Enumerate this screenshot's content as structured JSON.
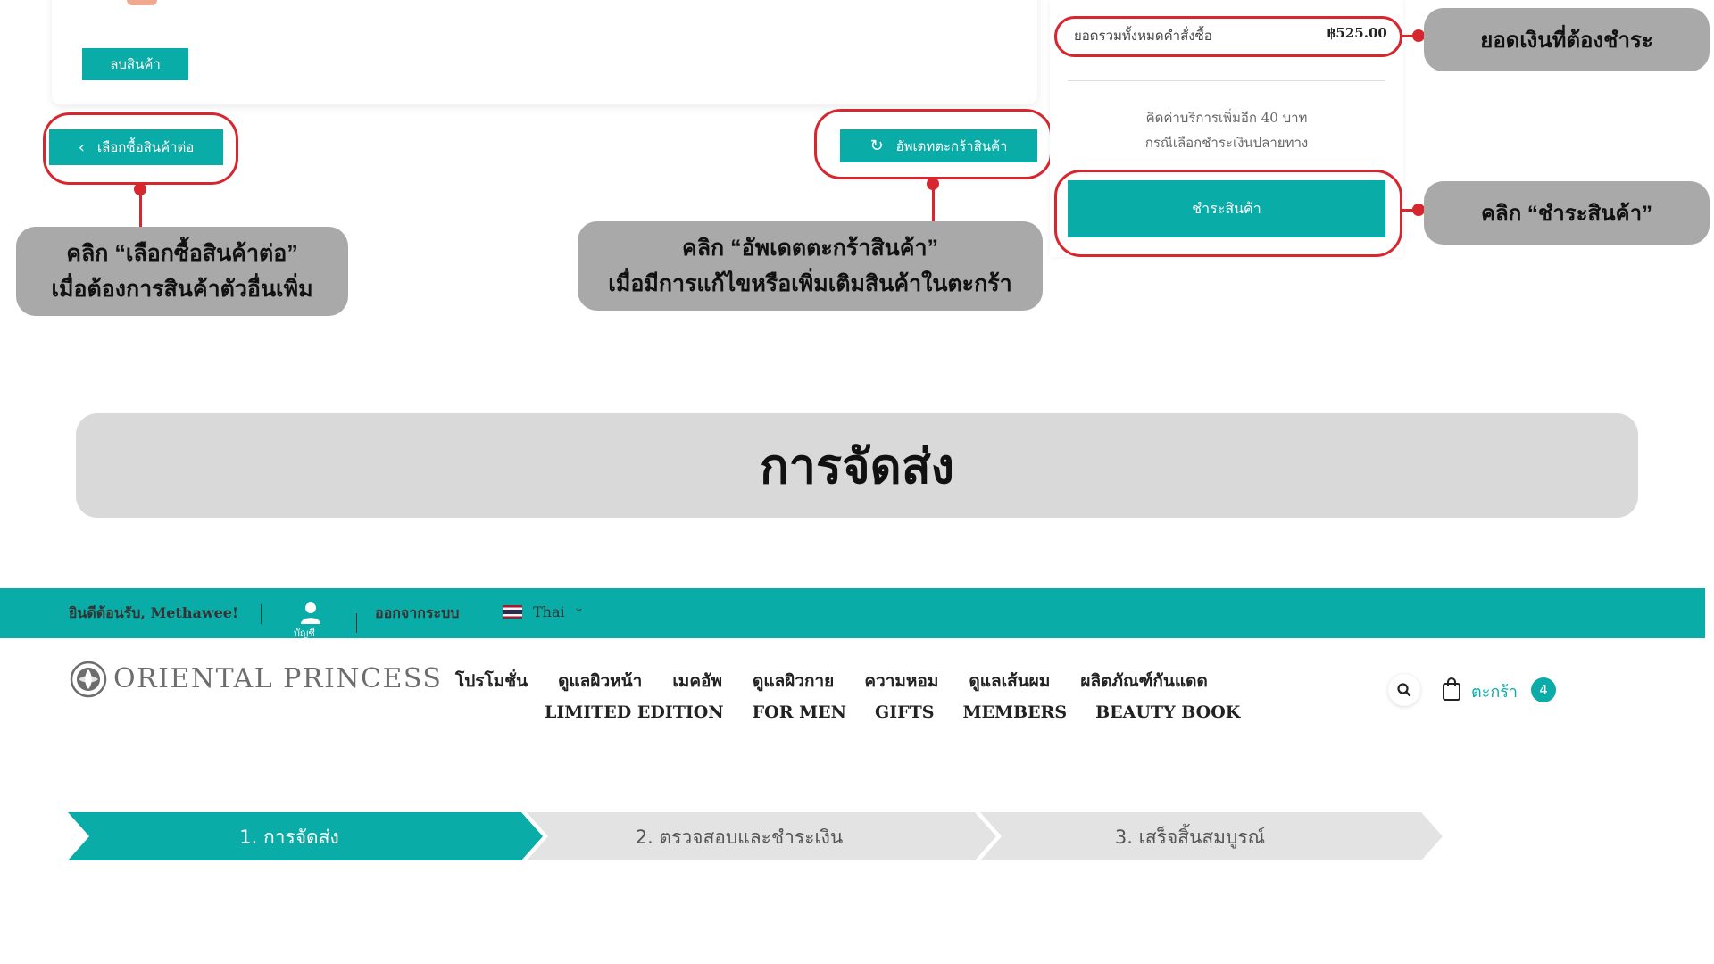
{
  "cart": {
    "remove_label": "ลบสินค้า",
    "continue_label": "เลือกซื้อสินค้าต่อ",
    "update_label": "อัพเดทตะกร้าสินค้า"
  },
  "summary": {
    "total_label": "ยอดรวมทั้งหมดคำสั่งซื้อ",
    "total_value": "฿525.00",
    "fee_note_line1": "คิดค่าบริการเพิ่มอีก 40 บาท",
    "fee_note_line2": "กรณีเลือกชำระเงินปลายทาง",
    "checkout_label": "ชำระสินค้า"
  },
  "annotations": {
    "total_callout": "ยอดเงินที่ต้องชำระ",
    "checkout_callout": "คลิก “ชำระสินค้า”",
    "continue_callout_line1": "คลิก “เลือกซื้อสินค้าต่อ”",
    "continue_callout_line2": "เมื่อต้องการสินค้าตัวอื่นเพิ่ม",
    "update_callout_line1": "คลิก “อัพเดตตะกร้าสินค้า”",
    "update_callout_line2": "เมื่อมีการแก้ไขหรือเพิ่มเติมสินค้าในตะกร้า",
    "accent_red": "#d8262f",
    "callout_gray": "#a9a9a9"
  },
  "section_title": "การจัดส่ง",
  "header": {
    "welcome": "ยินดีต้อนรับ, Methawee!",
    "account_label": "บัญชี",
    "logout": "ออกจากระบบ",
    "language": "Thai",
    "brand_color": "#0aaca8",
    "icons": [
      "user-icon",
      "thai-flag-icon",
      "chevron-down-icon",
      "search-icon",
      "shopping-bag-icon"
    ]
  },
  "brand": {
    "logo_text": "ORIENTAL PRINCESS"
  },
  "nav": {
    "row1": [
      "โปรโมชั่น",
      "ดูแลผิวหน้า",
      "เมคอัพ",
      "ดูแลผิวกาย",
      "ความหอม",
      "ดูแลเส้นผม",
      "ผลิตภัณฑ์กันแดด"
    ],
    "row2": [
      "LIMITED EDITION",
      "FOR MEN",
      "GIFTS",
      "MEMBERS",
      "BEAUTY BOOK"
    ]
  },
  "cart_widget": {
    "label": "ตะกร้า",
    "count": "4"
  },
  "steps": [
    {
      "label": "1. การจัดส่ง",
      "active": true
    },
    {
      "label": "2. ตรวจสอบและชำระเงิน",
      "active": false
    },
    {
      "label": "3. เสร็จสิ้นสมบูรณ์",
      "active": false
    }
  ]
}
